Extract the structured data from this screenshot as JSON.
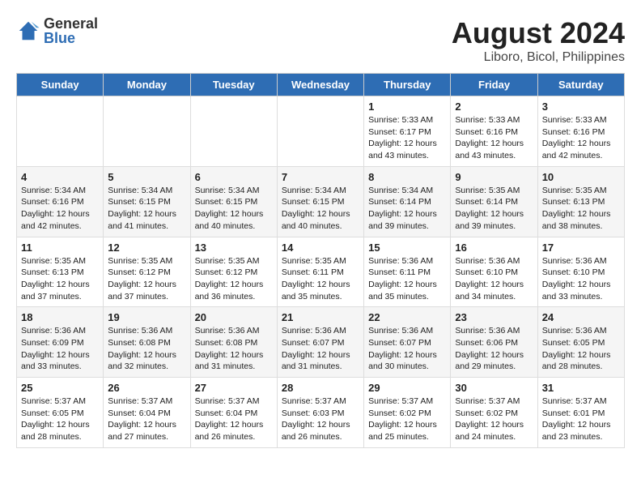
{
  "logo": {
    "general": "General",
    "blue": "Blue"
  },
  "title": "August 2024",
  "subtitle": "Liboro, Bicol, Philippines",
  "days_of_week": [
    "Sunday",
    "Monday",
    "Tuesday",
    "Wednesday",
    "Thursday",
    "Friday",
    "Saturday"
  ],
  "weeks": [
    [
      {
        "date": "",
        "content": ""
      },
      {
        "date": "",
        "content": ""
      },
      {
        "date": "",
        "content": ""
      },
      {
        "date": "",
        "content": ""
      },
      {
        "date": "1",
        "content": "Sunrise: 5:33 AM\nSunset: 6:17 PM\nDaylight: 12 hours\nand 43 minutes."
      },
      {
        "date": "2",
        "content": "Sunrise: 5:33 AM\nSunset: 6:16 PM\nDaylight: 12 hours\nand 43 minutes."
      },
      {
        "date": "3",
        "content": "Sunrise: 5:33 AM\nSunset: 6:16 PM\nDaylight: 12 hours\nand 42 minutes."
      }
    ],
    [
      {
        "date": "4",
        "content": "Sunrise: 5:34 AM\nSunset: 6:16 PM\nDaylight: 12 hours\nand 42 minutes."
      },
      {
        "date": "5",
        "content": "Sunrise: 5:34 AM\nSunset: 6:15 PM\nDaylight: 12 hours\nand 41 minutes."
      },
      {
        "date": "6",
        "content": "Sunrise: 5:34 AM\nSunset: 6:15 PM\nDaylight: 12 hours\nand 40 minutes."
      },
      {
        "date": "7",
        "content": "Sunrise: 5:34 AM\nSunset: 6:15 PM\nDaylight: 12 hours\nand 40 minutes."
      },
      {
        "date": "8",
        "content": "Sunrise: 5:34 AM\nSunset: 6:14 PM\nDaylight: 12 hours\nand 39 minutes."
      },
      {
        "date": "9",
        "content": "Sunrise: 5:35 AM\nSunset: 6:14 PM\nDaylight: 12 hours\nand 39 minutes."
      },
      {
        "date": "10",
        "content": "Sunrise: 5:35 AM\nSunset: 6:13 PM\nDaylight: 12 hours\nand 38 minutes."
      }
    ],
    [
      {
        "date": "11",
        "content": "Sunrise: 5:35 AM\nSunset: 6:13 PM\nDaylight: 12 hours\nand 37 minutes."
      },
      {
        "date": "12",
        "content": "Sunrise: 5:35 AM\nSunset: 6:12 PM\nDaylight: 12 hours\nand 37 minutes."
      },
      {
        "date": "13",
        "content": "Sunrise: 5:35 AM\nSunset: 6:12 PM\nDaylight: 12 hours\nand 36 minutes."
      },
      {
        "date": "14",
        "content": "Sunrise: 5:35 AM\nSunset: 6:11 PM\nDaylight: 12 hours\nand 35 minutes."
      },
      {
        "date": "15",
        "content": "Sunrise: 5:36 AM\nSunset: 6:11 PM\nDaylight: 12 hours\nand 35 minutes."
      },
      {
        "date": "16",
        "content": "Sunrise: 5:36 AM\nSunset: 6:10 PM\nDaylight: 12 hours\nand 34 minutes."
      },
      {
        "date": "17",
        "content": "Sunrise: 5:36 AM\nSunset: 6:10 PM\nDaylight: 12 hours\nand 33 minutes."
      }
    ],
    [
      {
        "date": "18",
        "content": "Sunrise: 5:36 AM\nSunset: 6:09 PM\nDaylight: 12 hours\nand 33 minutes."
      },
      {
        "date": "19",
        "content": "Sunrise: 5:36 AM\nSunset: 6:08 PM\nDaylight: 12 hours\nand 32 minutes."
      },
      {
        "date": "20",
        "content": "Sunrise: 5:36 AM\nSunset: 6:08 PM\nDaylight: 12 hours\nand 31 minutes."
      },
      {
        "date": "21",
        "content": "Sunrise: 5:36 AM\nSunset: 6:07 PM\nDaylight: 12 hours\nand 31 minutes."
      },
      {
        "date": "22",
        "content": "Sunrise: 5:36 AM\nSunset: 6:07 PM\nDaylight: 12 hours\nand 30 minutes."
      },
      {
        "date": "23",
        "content": "Sunrise: 5:36 AM\nSunset: 6:06 PM\nDaylight: 12 hours\nand 29 minutes."
      },
      {
        "date": "24",
        "content": "Sunrise: 5:36 AM\nSunset: 6:05 PM\nDaylight: 12 hours\nand 28 minutes."
      }
    ],
    [
      {
        "date": "25",
        "content": "Sunrise: 5:37 AM\nSunset: 6:05 PM\nDaylight: 12 hours\nand 28 minutes."
      },
      {
        "date": "26",
        "content": "Sunrise: 5:37 AM\nSunset: 6:04 PM\nDaylight: 12 hours\nand 27 minutes."
      },
      {
        "date": "27",
        "content": "Sunrise: 5:37 AM\nSunset: 6:04 PM\nDaylight: 12 hours\nand 26 minutes."
      },
      {
        "date": "28",
        "content": "Sunrise: 5:37 AM\nSunset: 6:03 PM\nDaylight: 12 hours\nand 26 minutes."
      },
      {
        "date": "29",
        "content": "Sunrise: 5:37 AM\nSunset: 6:02 PM\nDaylight: 12 hours\nand 25 minutes."
      },
      {
        "date": "30",
        "content": "Sunrise: 5:37 AM\nSunset: 6:02 PM\nDaylight: 12 hours\nand 24 minutes."
      },
      {
        "date": "31",
        "content": "Sunrise: 5:37 AM\nSunset: 6:01 PM\nDaylight: 12 hours\nand 23 minutes."
      }
    ]
  ]
}
